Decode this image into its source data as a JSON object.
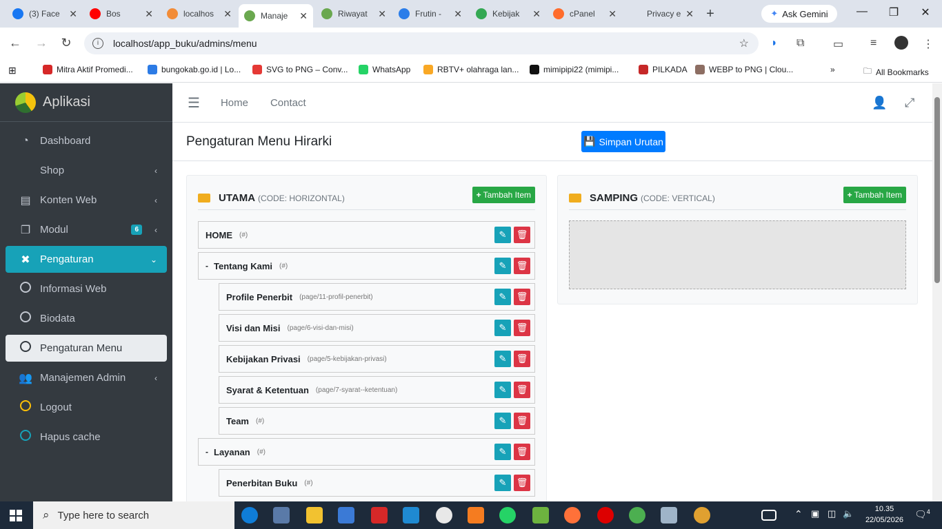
{
  "browser": {
    "tabs": [
      {
        "label": "(3) Face",
        "color": "#1877f2",
        "active": false
      },
      {
        "label": "Bos",
        "color": "#ff0000",
        "active": false
      },
      {
        "label": "localhos",
        "color": "#f28c38",
        "active": false
      },
      {
        "label": "Manaje",
        "color": "#6aa84f",
        "active": true
      },
      {
        "label": "Riwayat",
        "color": "#6aa84f",
        "active": false
      },
      {
        "label": "Frutin -",
        "color": "#2b7de9",
        "active": false
      },
      {
        "label": "Kebijak",
        "color": "#34a853",
        "active": false
      },
      {
        "label": "cPanel",
        "color": "#ff6c2c",
        "active": false
      },
      {
        "label": "Privacy erro",
        "color": "#dee3ec",
        "active": false
      }
    ],
    "gemini_label": "Ask Gemini",
    "url": "localhost/app_buku/admins/menu",
    "bookmarks": [
      {
        "label": "Mitra Aktif Promedi...",
        "color": "#d62828"
      },
      {
        "label": "bungokab.go.id | Lo...",
        "color": "#2c7be5"
      },
      {
        "label": "SVG to PNG – Conv...",
        "color": "#e53935"
      },
      {
        "label": "WhatsApp",
        "color": "#25d366"
      },
      {
        "label": "RBTV+ olahraga lan...",
        "color": "#f9a825"
      },
      {
        "label": "mimipipi22 (mimipi...",
        "color": "#111111"
      },
      {
        "label": "PILKADA",
        "color": "#c62828"
      },
      {
        "label": "WEBP to PNG | Clou...",
        "color": "#8d6e63"
      }
    ],
    "all_bookmarks": "All Bookmarks"
  },
  "sidebar": {
    "brand": "Aplikasi",
    "items": [
      {
        "label": "Dashboard",
        "icon": "dashboard-icon",
        "glyph": "◔",
        "state": "normal",
        "chev": ""
      },
      {
        "label": "Shop",
        "icon": "",
        "glyph": "",
        "state": "normal",
        "chev": "‹"
      },
      {
        "label": "Konten Web",
        "icon": "list-icon",
        "glyph": "▤",
        "state": "normal",
        "chev": "‹"
      },
      {
        "label": "Modul",
        "icon": "copy-icon",
        "glyph": "❐",
        "state": "normal",
        "chev": "‹",
        "badge": "6"
      },
      {
        "label": "Pengaturan",
        "icon": "tools-icon",
        "glyph": "✖",
        "state": "active",
        "chev": "⌄"
      },
      {
        "label": "Informasi Web",
        "icon": "circle-icon",
        "circle": "#c2c7d0",
        "state": "normal",
        "chev": ""
      },
      {
        "label": "Biodata",
        "icon": "circle-icon",
        "circle": "#c2c7d0",
        "state": "normal",
        "chev": ""
      },
      {
        "label": "Pengaturan Menu",
        "icon": "circle-icon",
        "circle": "#343a40",
        "state": "current",
        "chev": ""
      },
      {
        "label": "Manajemen Admin",
        "icon": "users-cog-icon",
        "glyph": "👥",
        "state": "normal",
        "chev": "‹"
      },
      {
        "label": "Logout",
        "icon": "circle-icon",
        "circle": "#ffc107",
        "state": "normal",
        "chev": ""
      },
      {
        "label": "Hapus cache",
        "icon": "circle-icon",
        "circle": "#17a2b8",
        "state": "normal",
        "chev": ""
      }
    ]
  },
  "topnav": {
    "home": "Home",
    "contact": "Contact"
  },
  "page": {
    "title": "Pengaturan Menu Hirarki",
    "save_label": "Simpan Urutan"
  },
  "panels": {
    "utama": {
      "title": "UTAMA",
      "code": "(CODE: HORIZONTAL)",
      "add_label": "Tambah Item",
      "rows": [
        {
          "name": "HOME",
          "url": "(#)",
          "level": 0,
          "collapse": false
        },
        {
          "name": "Tentang Kami",
          "url": "(#)",
          "level": 0,
          "collapse": true
        },
        {
          "name": "Profile Penerbit",
          "url": "(page/11-profil-penerbit)",
          "level": 1,
          "collapse": false
        },
        {
          "name": "Visi dan Misi",
          "url": "(page/6-visi-dan-misi)",
          "level": 1,
          "collapse": false
        },
        {
          "name": "Kebijakan Privasi",
          "url": "(page/5-kebijakan-privasi)",
          "level": 1,
          "collapse": false
        },
        {
          "name": "Syarat & Ketentuan",
          "url": "(page/7-syarat--ketentuan)",
          "level": 1,
          "collapse": false
        },
        {
          "name": "Team",
          "url": "(#)",
          "level": 1,
          "collapse": false
        },
        {
          "name": "Layanan",
          "url": "(#)",
          "level": 0,
          "collapse": true
        },
        {
          "name": "Penerbitan Buku",
          "url": "(#)",
          "level": 1,
          "collapse": false
        }
      ]
    },
    "samping": {
      "title": "SAMPING",
      "code": "(CODE: VERTICAL)",
      "add_label": "Tambah Item"
    }
  },
  "taskbar": {
    "search_placeholder": "Type here to search",
    "time": "10.35",
    "date": "22/05/2026",
    "notif_count": "4"
  }
}
